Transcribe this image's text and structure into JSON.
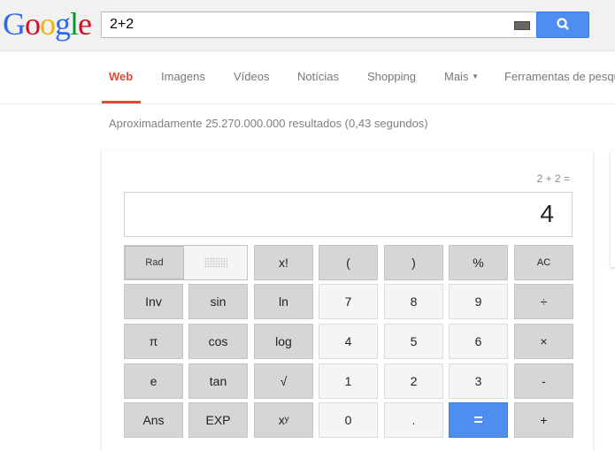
{
  "logo": "Google",
  "logo_colors": [
    "#3369e8",
    "#d50f25",
    "#eeb211",
    "#3369e8",
    "#009925",
    "#d50f25"
  ],
  "search": {
    "value": "2+2"
  },
  "nav": {
    "tabs": [
      "Web",
      "Imagens",
      "Vídeos",
      "Notícias",
      "Shopping",
      "Mais",
      "Ferramentas de pesqu"
    ],
    "active": "Web"
  },
  "stats": "Aproximadamente 25.270.000.000 resultados (0,43 segundos)",
  "calc": {
    "expression": "2 + 2 =",
    "result": "4",
    "mode": "Rad",
    "rows": [
      [
        "x!",
        "(",
        ")",
        "%",
        "AC"
      ],
      [
        "Inv",
        "sin",
        "ln",
        "7",
        "8",
        "9",
        "÷"
      ],
      [
        "π",
        "cos",
        "log",
        "4",
        "5",
        "6",
        "×"
      ],
      [
        "e",
        "tan",
        "√",
        "1",
        "2",
        "3",
        "-"
      ],
      [
        "Ans",
        "EXP",
        "xʸ",
        "0",
        ".",
        "=",
        "+"
      ]
    ]
  },
  "colors": {
    "accent": "#4d8ef0",
    "active_tab": "#dd4b39"
  }
}
